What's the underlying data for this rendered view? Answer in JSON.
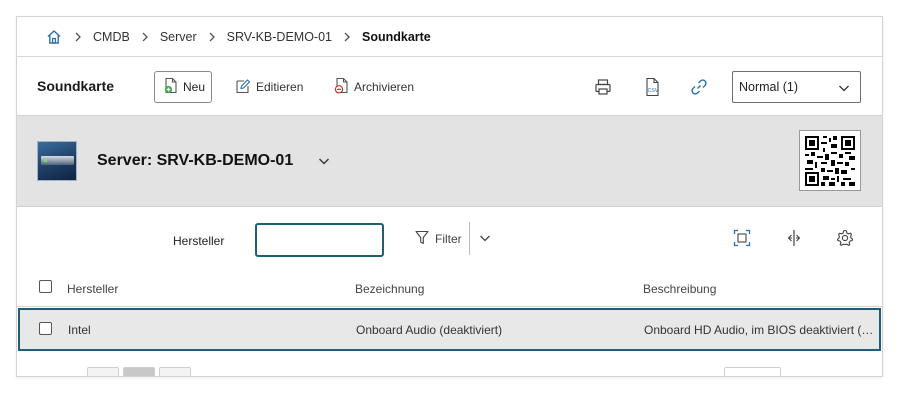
{
  "breadcrumb": {
    "home_icon": "home-icon",
    "items": [
      "CMDB",
      "Server",
      "SRV-KB-DEMO-01"
    ],
    "current": "Soundkarte"
  },
  "toolbar": {
    "title": "Soundkarte",
    "new_label": "Neu",
    "edit_label": "Editieren",
    "archive_label": "Archivieren",
    "view_select": "Normal (1)"
  },
  "object": {
    "title": "Server: SRV-KB-DEMO-01"
  },
  "filter": {
    "label": "Hersteller",
    "input_value": "",
    "filter_label": "Filter"
  },
  "table": {
    "columns": [
      "Hersteller",
      "Bezeichnung",
      "Beschreibung"
    ],
    "rows": [
      [
        "Intel",
        "Onboard Audio (deaktiviert)",
        "Onboard HD Audio, im BIOS deaktiviert (…"
      ]
    ]
  },
  "colors": {
    "accent": "#1f5f7a",
    "header_band": "#e3e3e3",
    "row_selected": "#e8e8e8",
    "link_icon": "#2a6fb0",
    "archive_icon": "#c0392b"
  }
}
